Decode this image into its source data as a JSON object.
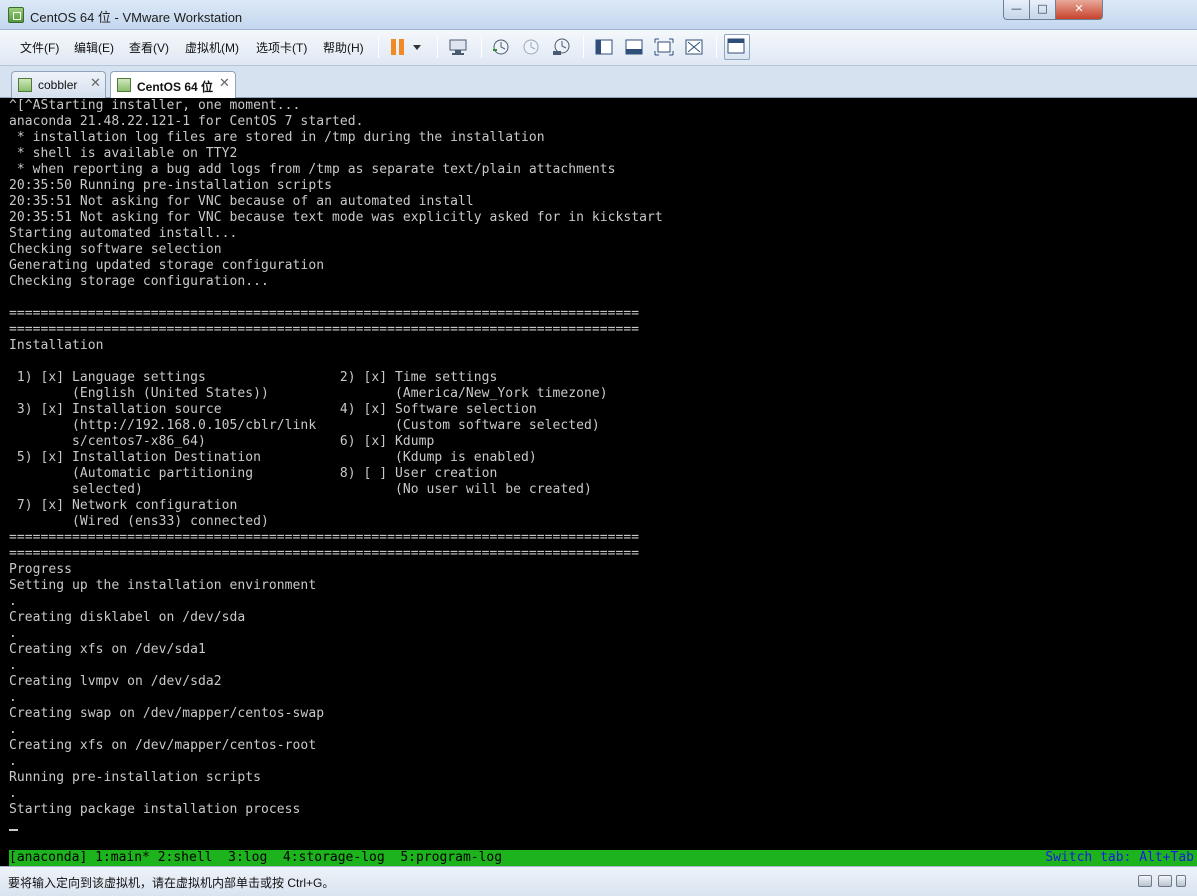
{
  "window": {
    "title": "CentOS 64 位 - VMware Workstation",
    "minimize_icon": "minimize-icon",
    "maximize_icon": "maximize-icon",
    "close_icon": "close-icon"
  },
  "menu": {
    "items": [
      "文件(F)",
      "编辑(E)",
      "查看(V)",
      "虚拟机(M)",
      "选项卡(T)",
      "帮助(H)"
    ]
  },
  "toolbar": {
    "icons": [
      "pause-icon",
      "dropdown-icon",
      "send-ctrl-alt-del-icon",
      "snapshot-take-icon",
      "snapshot-revert-icon",
      "snapshot-manager-icon",
      "sidebar-icon",
      "thumbnail-icon",
      "fullscreen-icon",
      "unity-icon",
      "console-view-icon"
    ]
  },
  "tabs": [
    {
      "label": "cobbler",
      "active": false
    },
    {
      "label": "CentOS 64 位",
      "active": true
    }
  ],
  "console": {
    "lines": [
      "^[^AStarting installer, one moment...",
      "anaconda 21.48.22.121-1 for CentOS 7 started.",
      " * installation log files are stored in /tmp during the installation",
      " * shell is available on TTY2",
      " * when reporting a bug add logs from /tmp as separate text/plain attachments",
      "20:35:50 Running pre-installation scripts",
      "20:35:51 Not asking for VNC because of an automated install",
      "20:35:51 Not asking for VNC because text mode was explicitly asked for in kickstart",
      "Starting automated install...",
      "Checking software selection",
      "Generating updated storage configuration",
      "Checking storage configuration...",
      "",
      "================================================================================",
      "================================================================================",
      "Installation",
      "",
      " 1) [x] Language settings                 2) [x] Time settings",
      "        (English (United States))                (America/New_York timezone)",
      " 3) [x] Installation source               4) [x] Software selection",
      "        (http://192.168.0.105/cblr/link          (Custom software selected)",
      "        s/centos7-x86_64)                 6) [x] Kdump",
      " 5) [x] Installation Destination                 (Kdump is enabled)",
      "        (Automatic partitioning           8) [ ] User creation",
      "        selected)                                (No user will be created)",
      " 7) [x] Network configuration",
      "        (Wired (ens33) connected)",
      "================================================================================",
      "================================================================================",
      "Progress",
      "Setting up the installation environment",
      ".",
      "Creating disklabel on /dev/sda",
      ".",
      "Creating xfs on /dev/sda1",
      ".",
      "Creating lvmpv on /dev/sda2",
      ".",
      "Creating swap on /dev/mapper/centos-swap",
      ".",
      "Creating xfs on /dev/mapper/centos-root",
      ".",
      "Running pre-installation scripts",
      ".",
      "Starting package installation process"
    ],
    "status_left": "[anaconda] 1:main* 2:shell  3:log  4:storage-log  5:program-log",
    "status_right": "Switch tab: Alt+Tab"
  },
  "statusbar": {
    "text": "要将输入定向到该虚拟机，请在虚拟机内部单击或按 Ctrl+G。",
    "device_icons": [
      "network-icon",
      "usb-icon",
      "sound-icon",
      "device-icon"
    ]
  }
}
